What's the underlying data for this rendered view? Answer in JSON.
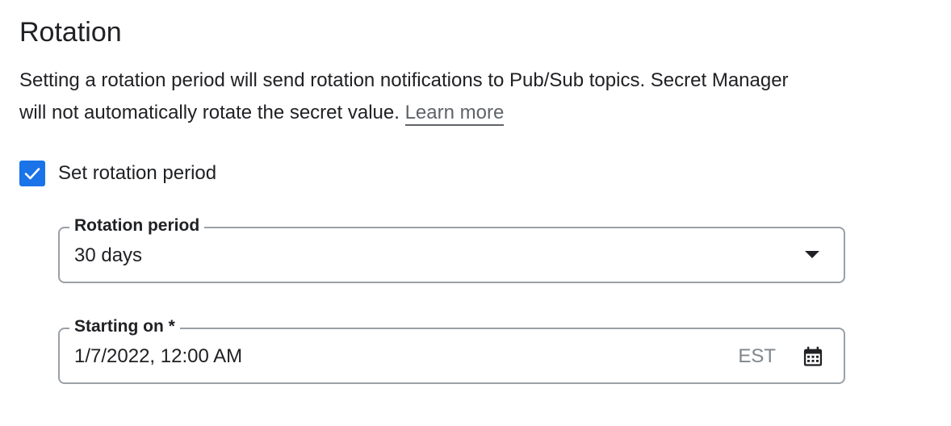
{
  "section": {
    "title": "Rotation",
    "description": "Setting a rotation period will send rotation notifications to Pub/Sub topics. Secret Manager will not automatically rotate the secret value.",
    "learn_more": "Learn more"
  },
  "checkbox": {
    "label": "Set rotation period",
    "checked": true
  },
  "rotation_period": {
    "label": "Rotation period",
    "value": "30 days"
  },
  "starting_on": {
    "label": "Starting on *",
    "value": "1/7/2022, 12:00 AM",
    "timezone": "EST"
  },
  "icons": {
    "checkbox": "check-icon",
    "dropdown": "dropdown-arrow-icon",
    "calendar": "calendar-icon"
  },
  "colors": {
    "accent": "#1a73e8",
    "border": "#9aa0a6",
    "text": "#202124",
    "muted": "#5f6368"
  }
}
